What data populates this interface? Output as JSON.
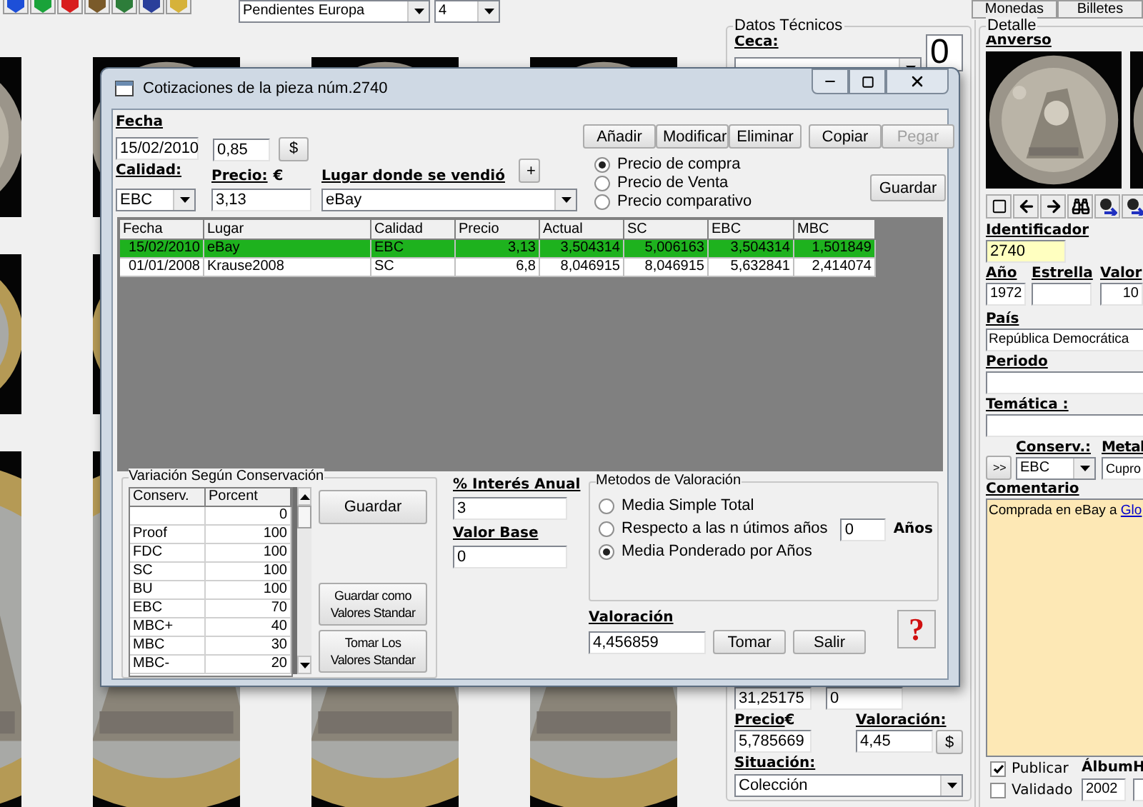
{
  "toolbar": {
    "filter": "Pendientes Europa",
    "page": "4"
  },
  "top_tabs": [
    {
      "label": "Monedas"
    },
    {
      "label": "Billetes"
    }
  ],
  "tech": {
    "title": "Datos Técnicos",
    "mint_label": "Ceca:",
    "counter": "0",
    "values": [
      "31,25175",
      "0"
    ],
    "price_label": "Precio",
    "currency": "€",
    "price": "5,785669",
    "valuation_label": "Valoración:",
    "valuation": "4,45",
    "currency_button": "$",
    "status_label": "Situación:",
    "status": "Colección"
  },
  "detail": {
    "title": "Detalle",
    "obverse_label": "Anverso",
    "id_label": "Identificador",
    "id": "2740",
    "year_label": "Año",
    "star_label": "Estrella",
    "value_label": "Valor",
    "year": "1972",
    "value": "10",
    "country_label": "País",
    "country": "República Democrática",
    "period_label": "Periodo",
    "theme_label": "Temática :",
    "expand_button": ">>",
    "grade_label": "Conserv.:",
    "metal_label": "Metal",
    "grade": "EBC",
    "metal": "Cupro",
    "comment_label": "Comentario",
    "comment": "Comprada en eBay a ",
    "comment_link": "Glo",
    "checks": [
      {
        "label": "Publicar",
        "checked": true
      },
      {
        "label": "Validado",
        "checked": false
      }
    ],
    "album_label": "Álbum",
    "album": "2002",
    "cut_label": "H"
  },
  "dialog": {
    "title": "Cotizaciones de la pieza núm.2740",
    "date_label": "Fecha",
    "date": "15/02/2010",
    "rate": "0,85",
    "rate_button": "$",
    "actions": [
      {
        "label": "Añadir",
        "disabled": false
      },
      {
        "label": "Modificar",
        "disabled": false
      },
      {
        "label": "Eliminar",
        "disabled": false
      },
      {
        "label": "Copiar",
        "disabled": false
      },
      {
        "label": "Pegar",
        "disabled": true
      }
    ],
    "quality_label": "Calidad:",
    "price_label": "Precio:",
    "currency": "€",
    "place_label": "Lugar donde se vendió",
    "add_place": "+",
    "quality": "EBC",
    "price": "3,13",
    "place": "eBay",
    "price_types": [
      {
        "label": "Precio de compra",
        "selected": true
      },
      {
        "label": "Precio de Venta",
        "selected": false
      },
      {
        "label": "Precio comparativo",
        "selected": false
      }
    ],
    "save": "Guardar",
    "table": {
      "columns": [
        "Fecha",
        "Lugar",
        "Calidad",
        "Precio",
        "Actual",
        "SC",
        "EBC",
        "MBC"
      ],
      "rows": [
        {
          "selected": true,
          "cells": [
            "15/02/2010",
            "eBay",
            "EBC",
            "3,13",
            "3,504314",
            "5,006163",
            "3,504314",
            "1,501849"
          ]
        },
        {
          "selected": false,
          "cells": [
            "01/01/2008",
            "Krause2008",
            "SC",
            "6,8",
            "8,046915",
            "8,046915",
            "5,632841",
            "2,414074"
          ]
        }
      ]
    },
    "variation": {
      "title": "Variación Según Conservación",
      "columns": [
        "Conserv.",
        "Porcent"
      ],
      "rows": [
        [
          "",
          "0"
        ],
        [
          "Proof",
          "100"
        ],
        [
          "FDC",
          "100"
        ],
        [
          "SC",
          "100"
        ],
        [
          "BU",
          "100"
        ],
        [
          "EBC",
          "70"
        ],
        [
          "MBC+",
          "40"
        ],
        [
          "MBC",
          "30"
        ],
        [
          "MBC-",
          "20"
        ]
      ],
      "save": "Guardar",
      "save_standard": "Guardar como Valores Standar",
      "load_standard": "Tomar Los Valores Standar"
    },
    "interest_label": "% Interés Anual",
    "interest": "3",
    "base_label": "Valor Base",
    "base": "0",
    "methods": {
      "title": "Metodos de Valoración",
      "options": [
        {
          "label": "Media Simple Total",
          "selected": false
        },
        {
          "label": "Respecto a las n útimos años",
          "selected": false
        },
        {
          "label": "Media Ponderado por Años",
          "selected": true
        }
      ],
      "years": "0",
      "years_label": "Años"
    },
    "valuation_label": "Valoración",
    "valuation": "4,456859",
    "take": "Tomar",
    "exit": "Salir",
    "help": "?"
  }
}
